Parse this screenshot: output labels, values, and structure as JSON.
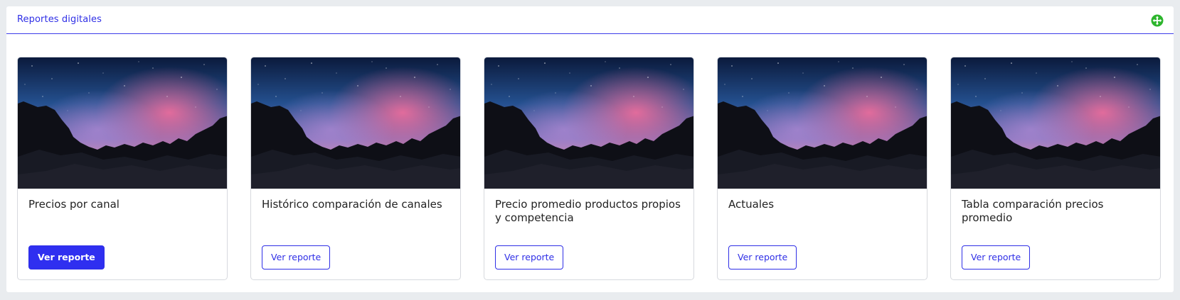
{
  "panel": {
    "title": "Reportes digitales",
    "header_icon": "move-arrows-icon",
    "accent_color": "#2f2fe6",
    "icon_color": "#2db52d"
  },
  "cards": [
    {
      "title": "Precios por canal",
      "button_label": "Ver reporte",
      "button_style": "primary",
      "image": "night-sky-rocks-image"
    },
    {
      "title": "Histórico comparación de canales",
      "button_label": "Ver reporte",
      "button_style": "outline",
      "image": "night-sky-rocks-image"
    },
    {
      "title": "Precio promedio productos propios y competencia",
      "button_label": "Ver reporte",
      "button_style": "outline",
      "image": "night-sky-rocks-image"
    },
    {
      "title": "Actuales",
      "button_label": "Ver reporte",
      "button_style": "outline",
      "image": "night-sky-rocks-image"
    },
    {
      "title": "Tabla comparación precios promedio",
      "button_label": "Ver reporte",
      "button_style": "outline",
      "image": "night-sky-rocks-image"
    }
  ]
}
